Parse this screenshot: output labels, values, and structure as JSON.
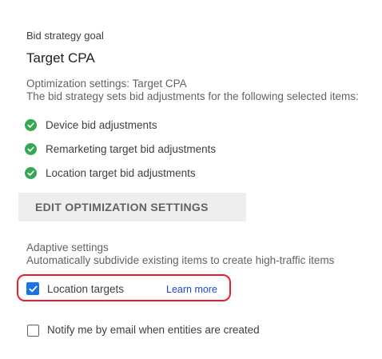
{
  "bid_strategy": {
    "section_label": "Bid strategy goal",
    "goal_value": "Target CPA"
  },
  "optimization": {
    "line1": "Optimization settings: Target CPA",
    "line2": "The bid strategy sets bid adjustments for the following selected items:",
    "items": [
      {
        "label": "Device bid adjustments",
        "icon": "check-circle-icon",
        "color": "#34a853"
      },
      {
        "label": "Remarketing target bid adjustments",
        "icon": "check-circle-icon",
        "color": "#34a853"
      },
      {
        "label": "Location target bid adjustments",
        "icon": "check-circle-icon",
        "color": "#34a853"
      }
    ],
    "edit_button_label": "EDIT OPTIMIZATION SETTINGS"
  },
  "adaptive": {
    "line1": "Adaptive settings",
    "line2": "Automatically subdivide existing items to create high-traffic items",
    "location_targets": {
      "label": "Location targets",
      "checked": true,
      "learn_more": "Learn more"
    },
    "notify": {
      "label": "Notify me by email when entities are created",
      "checked": false
    }
  },
  "colors": {
    "accent": "#1a73e8",
    "success": "#34a853",
    "highlight": "#e8202f",
    "link": "#1a47d4"
  }
}
